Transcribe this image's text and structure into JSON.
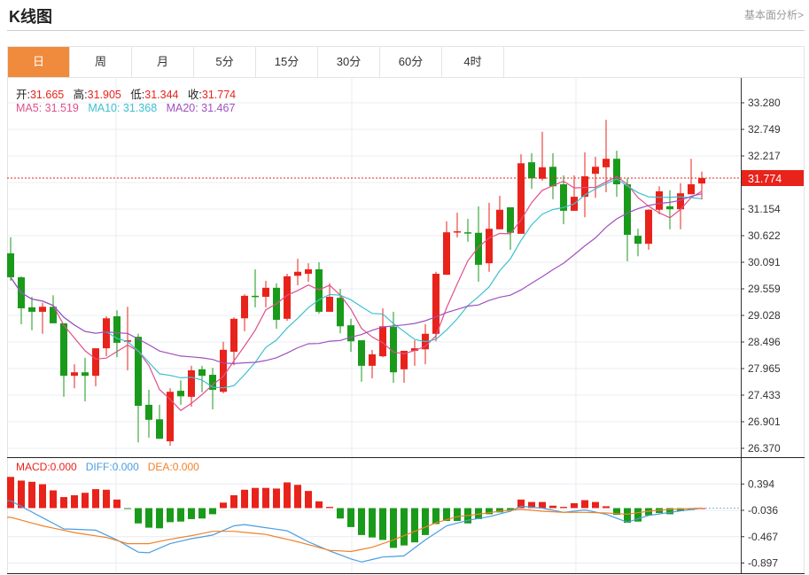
{
  "header": {
    "title": "K线图",
    "fundamental_link": "基本面分析>"
  },
  "tabs": [
    {
      "label": "日",
      "active": true
    },
    {
      "label": "周"
    },
    {
      "label": "月"
    },
    {
      "label": "5分"
    },
    {
      "label": "15分"
    },
    {
      "label": "30分"
    },
    {
      "label": "60分"
    },
    {
      "label": "4时"
    }
  ],
  "legend": {
    "open_label": "开:",
    "open": "31.665",
    "high_label": "高:",
    "high": "31.905",
    "low_label": "低:",
    "low": "31.344",
    "close_label": "收:",
    "close": "31.774",
    "ma5": "MA5: 31.519",
    "ma10": "MA10: 31.368",
    "ma20": "MA20: 31.467"
  },
  "macd_legend": {
    "macd": "MACD:0.000",
    "diff": "DIFF:0.000",
    "dea": "DEA:0.000"
  },
  "colors": {
    "up": "#E8231B",
    "down": "#1A9A1A",
    "ma5": "#E0508A",
    "ma10": "#3CC0D0",
    "ma20": "#A050C0",
    "diff": "#4A9EE0",
    "dea": "#F0822A",
    "accent": "#F08A3C"
  },
  "chart_data": [
    {
      "type": "candlestick",
      "ylim": [
        26.19,
        33.78
      ],
      "y_ticks": [
        "33.280",
        "32.749",
        "32.217",
        "31.686",
        "31.154",
        "30.622",
        "30.091",
        "29.559",
        "29.028",
        "28.496",
        "27.965",
        "27.433",
        "26.901",
        "26.370"
      ],
      "last_price": "31.774",
      "ohlc": [
        [
          30.27,
          30.59,
          29.72,
          29.79
        ],
        [
          29.79,
          29.81,
          28.85,
          29.17
        ],
        [
          29.19,
          29.4,
          28.73,
          29.1
        ],
        [
          29.1,
          29.28,
          28.66,
          29.2
        ],
        [
          29.2,
          29.43,
          28.87,
          28.87
        ],
        [
          28.87,
          28.87,
          27.4,
          27.82
        ],
        [
          27.82,
          28.05,
          27.57,
          27.89
        ],
        [
          27.89,
          28.18,
          27.31,
          27.82
        ],
        [
          27.82,
          28.37,
          27.61,
          28.37
        ],
        [
          28.37,
          29.01,
          28.21,
          28.97
        ],
        [
          29.01,
          29.13,
          28.19,
          28.48
        ],
        [
          28.5,
          29.2,
          27.93,
          28.53
        ],
        [
          28.6,
          28.66,
          26.49,
          27.22
        ],
        [
          27.24,
          27.54,
          26.58,
          26.94
        ],
        [
          26.95,
          27.24,
          26.56,
          26.56
        ],
        [
          26.51,
          27.57,
          26.42,
          27.5
        ],
        [
          27.52,
          27.73,
          27.24,
          27.41
        ],
        [
          27.4,
          28.02,
          27.2,
          27.93
        ],
        [
          27.95,
          28.02,
          27.49,
          27.82
        ],
        [
          27.84,
          27.98,
          27.15,
          27.54
        ],
        [
          27.5,
          28.5,
          27.47,
          28.34
        ],
        [
          28.3,
          28.99,
          28.03,
          28.96
        ],
        [
          28.97,
          29.45,
          28.71,
          29.42
        ],
        [
          29.42,
          29.95,
          29.19,
          29.4
        ],
        [
          29.4,
          29.72,
          29.19,
          29.58
        ],
        [
          29.58,
          29.67,
          28.76,
          28.94
        ],
        [
          28.96,
          29.86,
          28.92,
          29.81
        ],
        [
          29.82,
          30.16,
          29.63,
          29.9
        ],
        [
          29.86,
          30.07,
          29.7,
          29.95
        ],
        [
          29.95,
          30.09,
          29.06,
          29.1
        ],
        [
          29.1,
          29.67,
          29.1,
          29.4
        ],
        [
          29.38,
          29.56,
          28.67,
          28.81
        ],
        [
          28.83,
          28.96,
          28.3,
          28.51
        ],
        [
          28.53,
          28.53,
          27.7,
          28.02
        ],
        [
          28.02,
          28.34,
          27.77,
          28.25
        ],
        [
          28.21,
          29.17,
          28.19,
          28.81
        ],
        [
          28.8,
          29.1,
          27.68,
          27.89
        ],
        [
          27.95,
          28.32,
          27.68,
          28.32
        ],
        [
          28.32,
          28.53,
          28.02,
          28.37
        ],
        [
          28.35,
          28.85,
          28.05,
          28.66
        ],
        [
          28.66,
          29.9,
          28.51,
          29.86
        ],
        [
          29.84,
          30.91,
          29.84,
          30.69
        ],
        [
          30.69,
          31.08,
          30.59,
          30.71
        ],
        [
          30.69,
          30.96,
          30.5,
          30.68
        ],
        [
          30.68,
          31.21,
          29.7,
          30.04
        ],
        [
          30.07,
          31.28,
          29.9,
          30.76
        ],
        [
          30.75,
          31.42,
          30.75,
          31.14
        ],
        [
          31.19,
          31.19,
          30.34,
          30.68
        ],
        [
          30.66,
          32.25,
          30.66,
          32.07
        ],
        [
          32.09,
          32.27,
          31.56,
          31.77
        ],
        [
          31.76,
          32.7,
          31.72,
          31.99
        ],
        [
          32.0,
          32.27,
          31.35,
          31.61
        ],
        [
          31.65,
          31.83,
          30.85,
          31.12
        ],
        [
          31.12,
          31.83,
          31.12,
          31.4
        ],
        [
          31.4,
          32.29,
          30.99,
          31.81
        ],
        [
          31.86,
          32.2,
          31.38,
          32.0
        ],
        [
          31.99,
          32.94,
          31.49,
          32.16
        ],
        [
          32.16,
          32.32,
          31.4,
          31.65
        ],
        [
          31.65,
          31.77,
          30.11,
          30.64
        ],
        [
          30.62,
          30.76,
          30.21,
          30.46
        ],
        [
          30.46,
          31.15,
          30.34,
          31.14
        ],
        [
          31.14,
          31.61,
          31.05,
          31.51
        ],
        [
          31.21,
          31.53,
          30.75,
          31.15
        ],
        [
          31.15,
          31.67,
          30.75,
          31.47
        ],
        [
          31.45,
          32.16,
          31.45,
          31.65
        ],
        [
          31.665,
          31.905,
          31.344,
          31.774
        ]
      ],
      "ma_periods": [
        5,
        10,
        20
      ]
    },
    {
      "type": "bar+line",
      "y_ticks": [
        "0.394",
        "-0.036",
        "-0.467",
        "-0.897"
      ],
      "macd": [
        0.51,
        0.45,
        0.43,
        0.39,
        0.29,
        0.18,
        0.21,
        0.25,
        0.31,
        0.3,
        0.14,
        -0.01,
        -0.25,
        -0.32,
        -0.33,
        -0.23,
        -0.22,
        -0.18,
        -0.17,
        -0.1,
        0.09,
        0.21,
        0.3,
        0.33,
        0.33,
        0.32,
        0.42,
        0.38,
        0.28,
        0.11,
        0.02,
        -0.17,
        -0.31,
        -0.44,
        -0.48,
        -0.52,
        -0.65,
        -0.61,
        -0.56,
        -0.44,
        -0.26,
        -0.21,
        -0.21,
        -0.25,
        -0.18,
        -0.1,
        -0.07,
        -0.04,
        0.14,
        0.1,
        0.1,
        0.04,
        0.02,
        0.08,
        0.13,
        0.1,
        0.03,
        -0.11,
        -0.24,
        -0.22,
        -0.12,
        -0.08,
        -0.1,
        -0.05,
        -0.03,
        0.0
      ],
      "diff": [
        [
          0,
          0.12
        ],
        [
          5,
          -0.34
        ],
        [
          8,
          -0.36
        ],
        [
          10,
          -0.52
        ],
        [
          12,
          -0.72
        ],
        [
          13,
          -0.73
        ],
        [
          15,
          -0.58
        ],
        [
          17,
          -0.5
        ],
        [
          19,
          -0.44
        ],
        [
          21,
          -0.29
        ],
        [
          22,
          -0.27
        ],
        [
          24,
          -0.32
        ],
        [
          26,
          -0.37
        ],
        [
          28,
          -0.55
        ],
        [
          30,
          -0.7
        ],
        [
          32,
          -0.83
        ],
        [
          33,
          -0.88
        ],
        [
          35,
          -0.8
        ],
        [
          37,
          -0.78
        ],
        [
          39,
          -0.52
        ],
        [
          41,
          -0.29
        ],
        [
          43,
          -0.2
        ],
        [
          45,
          -0.14
        ],
        [
          47,
          -0.05
        ],
        [
          48,
          0.03
        ],
        [
          50,
          0.0
        ],
        [
          52,
          -0.07
        ],
        [
          54,
          -0.03
        ],
        [
          56,
          -0.1
        ],
        [
          58,
          -0.23
        ],
        [
          60,
          -0.12
        ],
        [
          62,
          -0.07
        ],
        [
          65,
          0.0
        ]
      ],
      "dea": [
        [
          0,
          -0.15
        ],
        [
          3,
          -0.29
        ],
        [
          6,
          -0.4
        ],
        [
          9,
          -0.48
        ],
        [
          11,
          -0.58
        ],
        [
          13,
          -0.58
        ],
        [
          15,
          -0.51
        ],
        [
          17,
          -0.45
        ],
        [
          19,
          -0.38
        ],
        [
          21,
          -0.38
        ],
        [
          24,
          -0.43
        ],
        [
          27,
          -0.55
        ],
        [
          30,
          -0.69
        ],
        [
          32,
          -0.71
        ],
        [
          34,
          -0.64
        ],
        [
          36,
          -0.52
        ],
        [
          38,
          -0.38
        ],
        [
          40,
          -0.24
        ],
        [
          42,
          -0.14
        ],
        [
          44,
          -0.1
        ],
        [
          46,
          -0.05
        ],
        [
          48,
          -0.02
        ],
        [
          50,
          -0.05
        ],
        [
          52,
          -0.07
        ],
        [
          54,
          -0.07
        ],
        [
          56,
          -0.08
        ],
        [
          58,
          -0.1
        ],
        [
          60,
          -0.05
        ],
        [
          62,
          -0.02
        ],
        [
          65,
          0.0
        ]
      ]
    }
  ]
}
